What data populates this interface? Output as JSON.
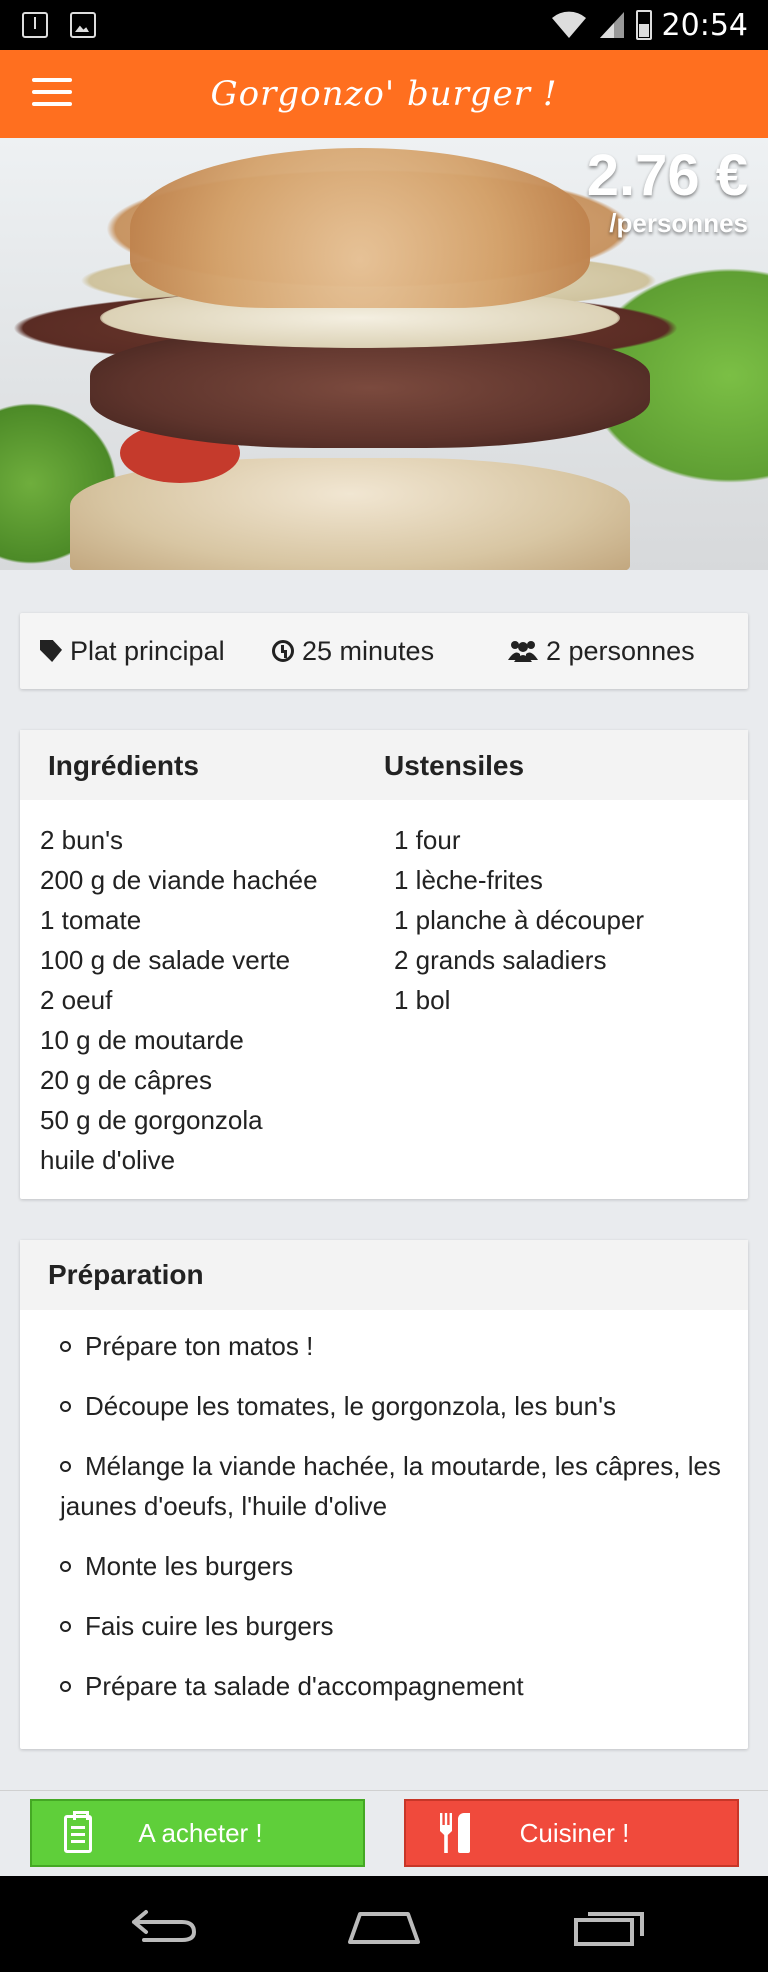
{
  "status_bar": {
    "time": "20:54",
    "left_icons": [
      "download-icon",
      "image-icon"
    ],
    "right_icons": [
      "wifi-icon",
      "signal-icon",
      "battery-icon"
    ]
  },
  "app_bar": {
    "title": "Gorgonzo' burger !",
    "menu_icon": "menu-icon"
  },
  "hero": {
    "price": "2.76 €",
    "price_unit": "/personnes"
  },
  "info": {
    "category_icon": "tag-icon",
    "category": "Plat principal",
    "time_icon": "clock-icon",
    "time": "25 minutes",
    "servings_icon": "users-icon",
    "servings": "2 personnes"
  },
  "ingredients": {
    "title": "Ingrédients",
    "items": [
      "2 bun's",
      "200 g de viande hachée",
      "1 tomate",
      "100 g de salade verte",
      "2 oeuf",
      "10 g de moutarde",
      "20 g de câpres",
      "50 g de gorgonzola",
      "huile d'olive"
    ]
  },
  "utensils": {
    "title": "Ustensiles",
    "items": [
      "1 four",
      "1 lèche-frites",
      "1 planche à découper",
      "2 grands saladiers",
      "1 bol"
    ]
  },
  "preparation": {
    "title": "Préparation",
    "steps": [
      "Prépare ton matos !",
      "Découpe les tomates, le gorgonzola, les bun's",
      "Mélange la viande hachée, la moutarde, les câpres, les jaunes d'oeufs, l'huile d'olive",
      "Monte les burgers",
      "Fais cuire les burgers",
      "Prépare ta salade d'accompagnement"
    ]
  },
  "actions": {
    "buy_label": "A acheter !",
    "buy_icon": "clipboard-icon",
    "buy_color": "#5fcf3a",
    "cook_label": "Cuisiner !",
    "cook_icon": "cutlery-icon",
    "cook_color": "#f04a3c"
  },
  "nav_bar": {
    "icons": [
      "back-icon",
      "home-icon",
      "recent-apps-icon"
    ]
  },
  "colors": {
    "brand": "#ff6f1f",
    "background": "#e9ebee"
  }
}
